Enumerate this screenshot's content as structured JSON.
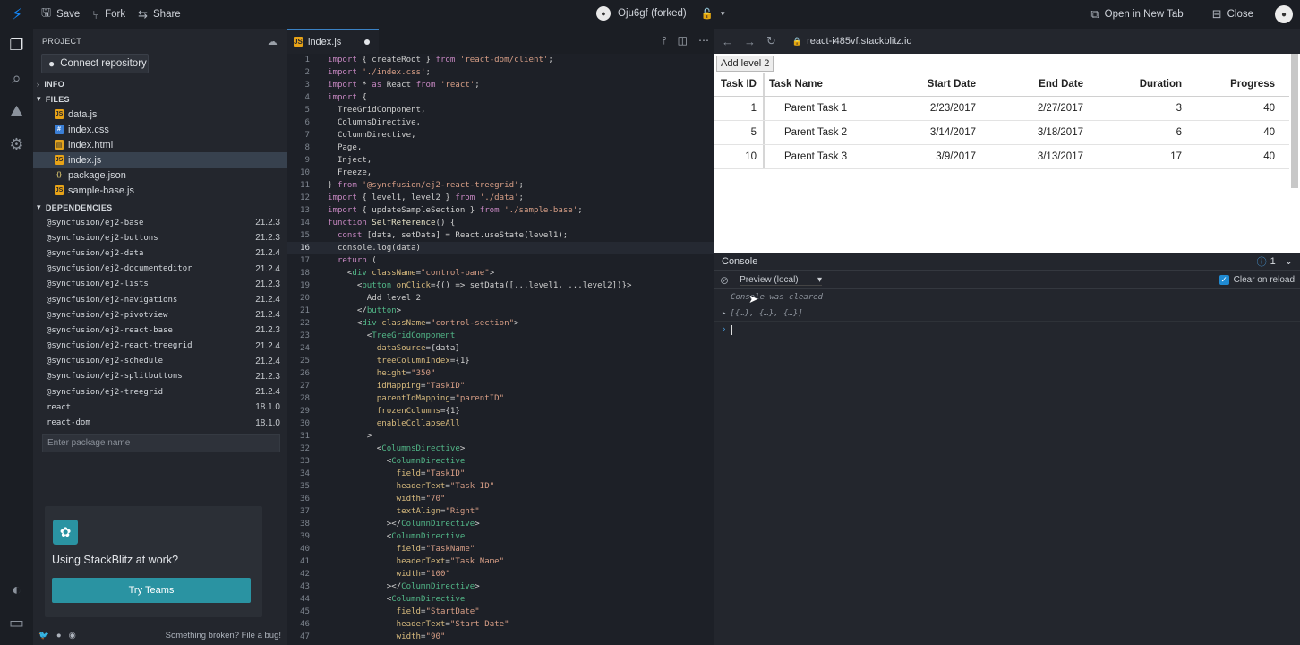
{
  "topbar": {
    "save": "Save",
    "fork": "Fork",
    "share": "Share",
    "project_name": "Oju6gf (forked)",
    "open_new_tab": "Open in New Tab",
    "close": "Close"
  },
  "sidebar": {
    "project_label": "PROJECT",
    "connect_repo": "Connect repository",
    "info_label": "INFO",
    "files_label": "FILES",
    "files": [
      {
        "name": "data.js",
        "type": "js"
      },
      {
        "name": "index.css",
        "type": "css"
      },
      {
        "name": "index.html",
        "type": "html"
      },
      {
        "name": "index.js",
        "type": "js"
      },
      {
        "name": "package.json",
        "type": "json"
      },
      {
        "name": "sample-base.js",
        "type": "js"
      }
    ],
    "dependencies_label": "DEPENDENCIES",
    "dependencies": [
      {
        "name": "@syncfusion/ej2-base",
        "version": "21.2.3"
      },
      {
        "name": "@syncfusion/ej2-buttons",
        "version": "21.2.3"
      },
      {
        "name": "@syncfusion/ej2-data",
        "version": "21.2.4"
      },
      {
        "name": "@syncfusion/ej2-documenteditor",
        "version": "21.2.4"
      },
      {
        "name": "@syncfusion/ej2-lists",
        "version": "21.2.3"
      },
      {
        "name": "@syncfusion/ej2-navigations",
        "version": "21.2.4"
      },
      {
        "name": "@syncfusion/ej2-pivotview",
        "version": "21.2.4"
      },
      {
        "name": "@syncfusion/ej2-react-base",
        "version": "21.2.3"
      },
      {
        "name": "@syncfusion/ej2-react-treegrid",
        "version": "21.2.4"
      },
      {
        "name": "@syncfusion/ej2-schedule",
        "version": "21.2.4"
      },
      {
        "name": "@syncfusion/ej2-splitbuttons",
        "version": "21.2.3"
      },
      {
        "name": "@syncfusion/ej2-treegrid",
        "version": "21.2.4"
      },
      {
        "name": "react",
        "version": "18.1.0"
      },
      {
        "name": "react-dom",
        "version": "18.1.0"
      }
    ],
    "package_placeholder": "Enter package name",
    "promo_text": "Using StackBlitz at work?",
    "promo_button": "Try Teams",
    "footer_text": "Something broken? File a bug!"
  },
  "editor": {
    "tab_name": "index.js"
  },
  "preview": {
    "url": "react-i485vf.stackblitz.io",
    "add_button": "Add level 2",
    "columns": [
      "Task ID",
      "Task Name",
      "Start Date",
      "End Date",
      "Duration",
      "Progress"
    ],
    "rows": [
      [
        "1",
        "Parent Task 1",
        "2/23/2017",
        "2/27/2017",
        "3",
        "40"
      ],
      [
        "5",
        "Parent Task 2",
        "3/14/2017",
        "3/18/2017",
        "6",
        "40"
      ],
      [
        "10",
        "Parent Task 3",
        "3/9/2017",
        "3/13/2017",
        "17",
        "40"
      ]
    ]
  },
  "console": {
    "title": "Console",
    "count": "1",
    "source": "Preview (local)",
    "clear_on_reload": "Clear on reload",
    "cleared": "Console was cleared",
    "log_entry": "[{…}, {…}, {…}]"
  }
}
